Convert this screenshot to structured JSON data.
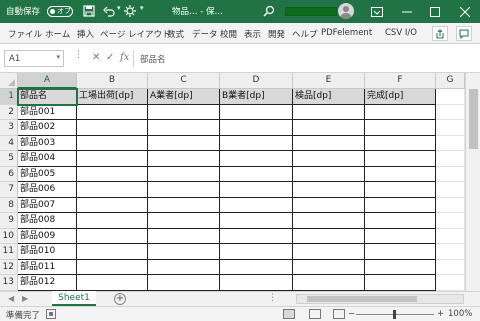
{
  "titlebar": {
    "autosave_label": "自動保存",
    "autosave_state": "オフ",
    "title": "物品… - 保…",
    "colors": {
      "accent": "#217346"
    },
    "icons": [
      "save-icon",
      "undo-icon",
      "redo-icon",
      "customize-icon",
      "search-icon",
      "account-icon",
      "minimize-icon",
      "restore-icon",
      "close-icon"
    ]
  },
  "ribbon": {
    "tabs": [
      "ファイル",
      "ホーム",
      "挿入",
      "ページ レイアウト",
      "数式",
      "データ",
      "校閲",
      "表示",
      "開発",
      "ヘルプ",
      "PDFelement",
      "CSV I/O"
    ]
  },
  "formula_bar": {
    "name_box": "A1",
    "formula": "部品名",
    "fx_label": "fx"
  },
  "grid": {
    "columns": [
      "A",
      "B",
      "C",
      "D",
      "E",
      "F",
      "G"
    ],
    "rows": [
      "1",
      "2",
      "3",
      "4",
      "5",
      "6",
      "7",
      "8",
      "9",
      "10",
      "11",
      "12",
      "13"
    ],
    "header_row": [
      "部品名",
      "工場出荷[dp]",
      "A業者[dp]",
      "B業者[dp]",
      "検品[dp]",
      "完成[dp]"
    ],
    "part_names": [
      "部品001",
      "部品002",
      "部品003",
      "部品004",
      "部品005",
      "部品006",
      "部品007",
      "部品008",
      "部品009",
      "部品010",
      "部品011",
      "部品012"
    ]
  },
  "sheets": {
    "tabs": [
      "Sheet1"
    ],
    "active": "Sheet1",
    "add_label": "+"
  },
  "status": {
    "ready_text": "準備完了",
    "zoom_out": "−",
    "zoom_in": "+",
    "zoom_level": "100%"
  }
}
